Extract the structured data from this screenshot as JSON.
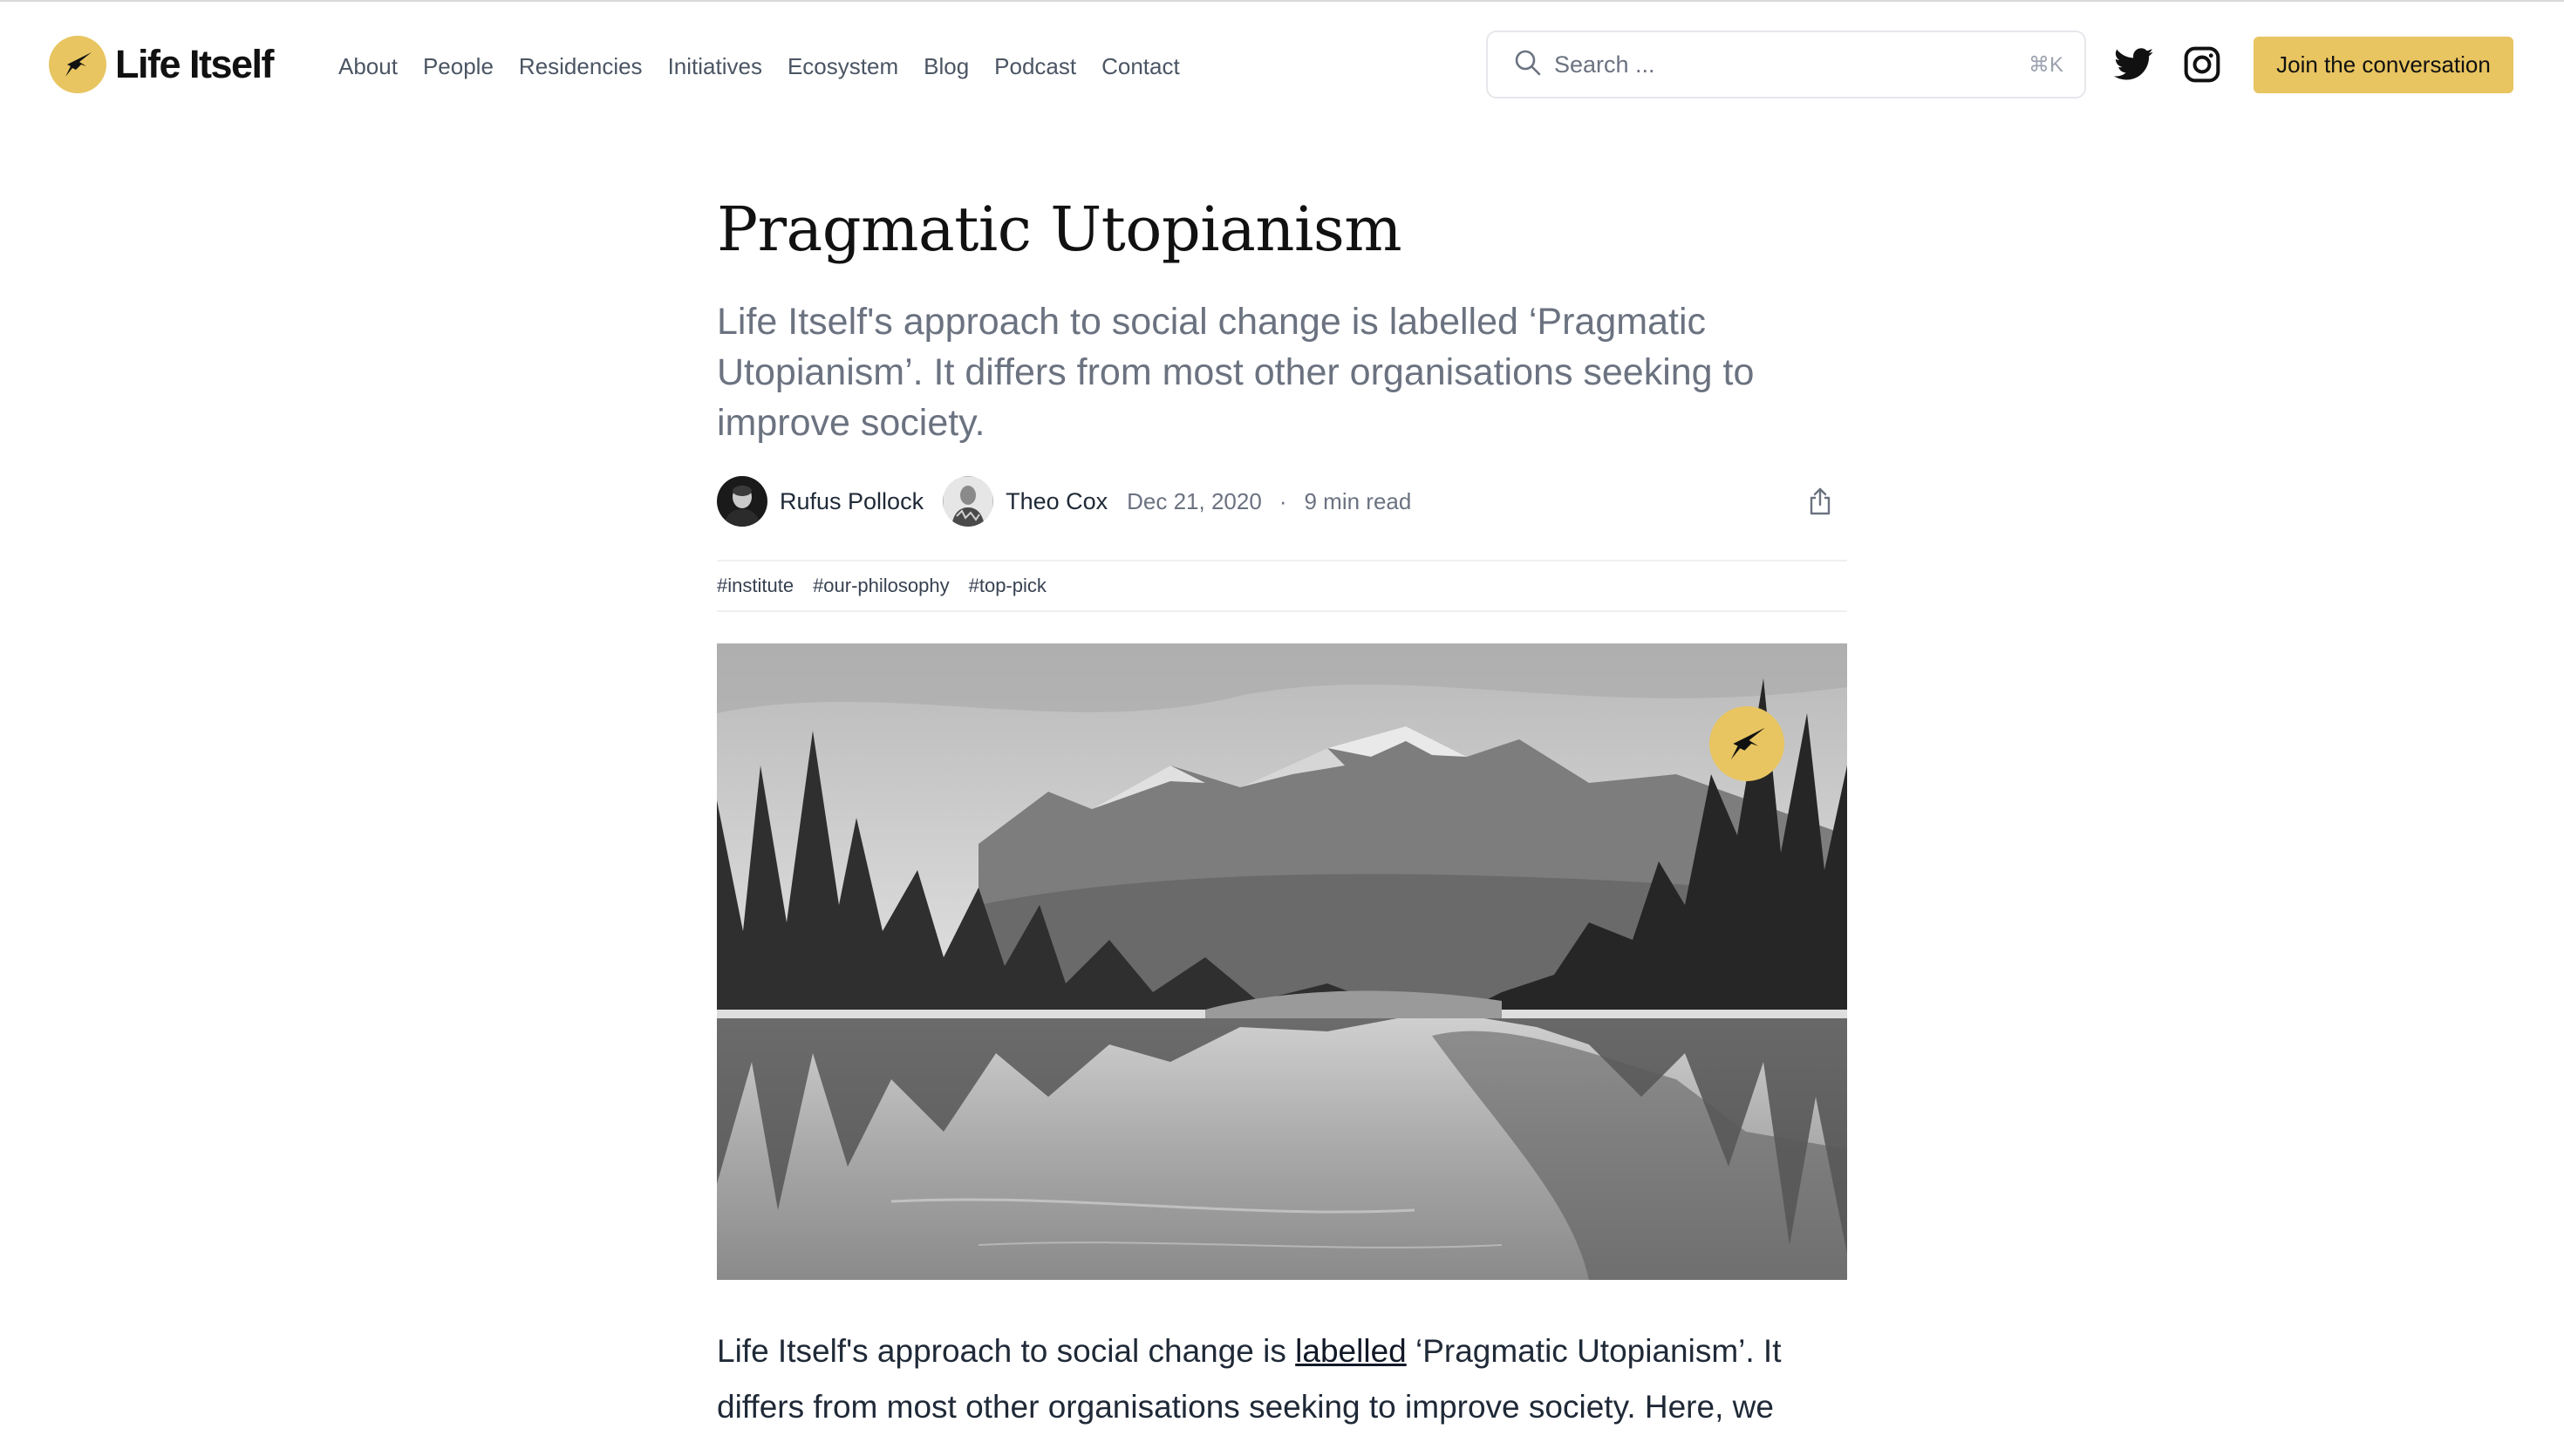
{
  "header": {
    "logo_text": "Life Itself",
    "nav": [
      {
        "label": "About"
      },
      {
        "label": "People"
      },
      {
        "label": "Residencies"
      },
      {
        "label": "Initiatives"
      },
      {
        "label": "Ecosystem"
      },
      {
        "label": "Blog"
      },
      {
        "label": "Podcast"
      },
      {
        "label": "Contact"
      }
    ],
    "search": {
      "placeholder": "Search ...",
      "shortcut": "⌘K",
      "icon": "search-icon"
    },
    "social": [
      {
        "icon": "twitter-icon"
      },
      {
        "icon": "instagram-icon"
      }
    ],
    "cta_label": "Join the conversation"
  },
  "article": {
    "title": "Pragmatic Utopianism",
    "lead": "Life Itself's approach to social change is labelled ‘Pragmatic Utopianism’. It differs from most other organisations seeking to improve society.",
    "authors": [
      {
        "name": "Rufus Pollock"
      },
      {
        "name": "Theo Cox"
      }
    ],
    "date": "Dec 21, 2020",
    "separator": "·",
    "read_time": "9 min read",
    "tags": [
      "#institute",
      "#our-philosophy",
      "#top-pick"
    ],
    "body_before_link": "Life Itself's approach to social change is ",
    "body_link": "labelled",
    "body_after_link": " ‘Pragmatic Utopianism’. It differs from most other organisations seeking to improve society. Here, we"
  },
  "colors": {
    "accent": "#e8c561",
    "text": "#111827",
    "muted": "#6b7280",
    "nav": "#4b5563"
  }
}
